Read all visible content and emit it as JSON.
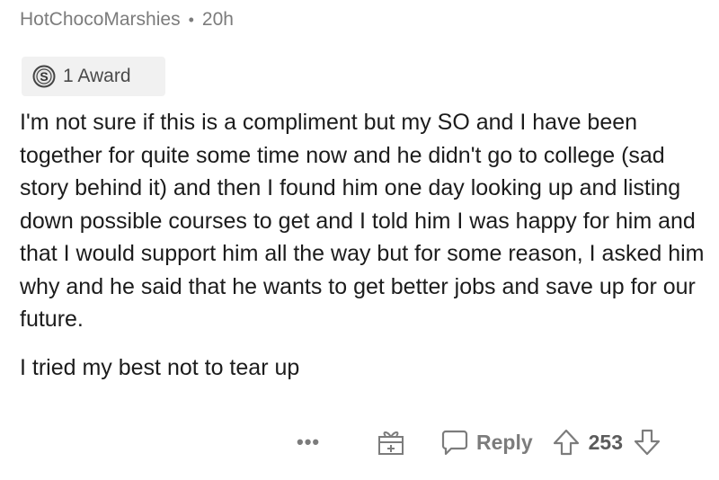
{
  "comment": {
    "author": "HotChocoMarshies",
    "separator": "•",
    "age": "20h",
    "award_label": "1 Award",
    "paragraphs": [
      "I'm not sure if this is a compliment but my SO and I have been together for quite some time now and he didn't go to college (sad story behind it) and then I found him one day looking up and listing down possible courses to get and I told him I was happy for him and that I would support him all the way but for some reason, I asked him why and he said that he wants to get better jobs and save up for our future.",
      "I tried my best not to tear up"
    ]
  },
  "actions": {
    "more_label": "•••",
    "reply_label": "Reply",
    "score": "253"
  },
  "icons": {
    "award": "silver-award-icon",
    "gift": "gift-award-icon",
    "reply": "comment-bubble-icon",
    "upvote": "upvote-arrow-icon",
    "downvote": "downvote-arrow-icon"
  }
}
